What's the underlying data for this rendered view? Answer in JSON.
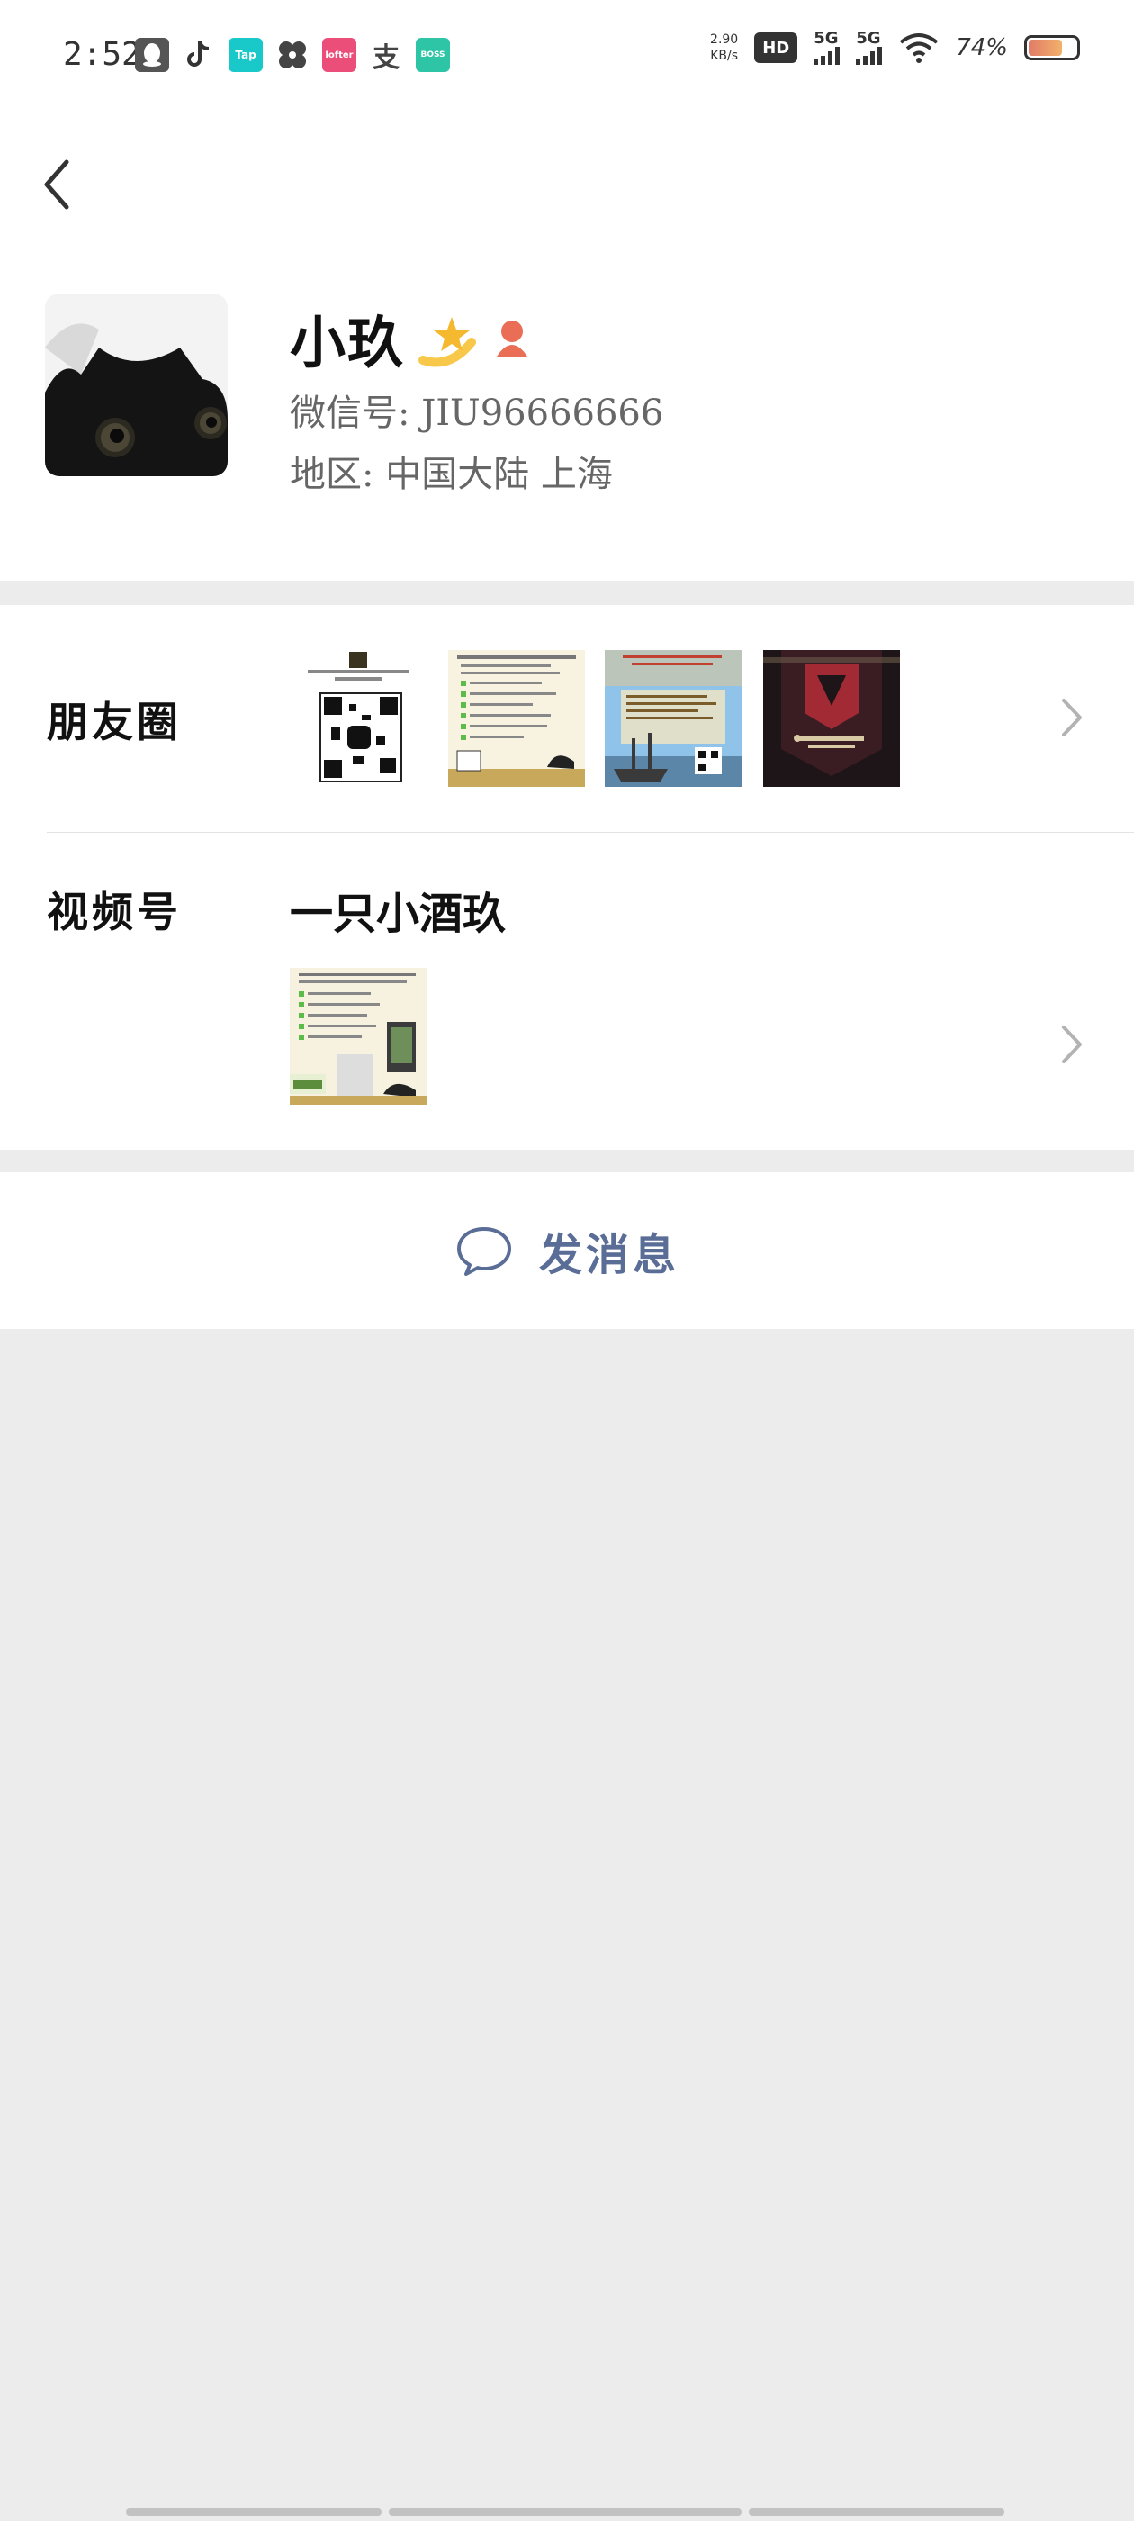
{
  "status_bar": {
    "time": "2:52",
    "net_speed_value": "2.90",
    "net_speed_unit": "KB/s",
    "hd_label": "HD",
    "signal1_label": "5G",
    "signal2_label": "5G",
    "battery_percent": "74%",
    "battery_level": 0.74,
    "app_icons": [
      {
        "name": "qq-icon",
        "color": "#555555",
        "text": ""
      },
      {
        "name": "tiktok-icon",
        "color": "#333333",
        "text": ""
      },
      {
        "name": "taptap-icon",
        "color": "#19c8c8",
        "text": "Tap"
      },
      {
        "name": "pinwheel-icon",
        "color": "#444444",
        "text": ""
      },
      {
        "name": "lofter-icon",
        "color": "#ea4e79",
        "text": "lofter"
      },
      {
        "name": "alipay-icon",
        "color": "#444444",
        "text": "支"
      },
      {
        "name": "boss-zhipin-icon",
        "color": "#2ec4a6",
        "text": "BOSS"
      }
    ]
  },
  "profile": {
    "nickname": "小玖",
    "wechat_id_line": "微信号: JIU96666666",
    "region_line": "地区: 中国大陆 上海"
  },
  "moments": {
    "label": "朋友圈",
    "thumbnails": [
      "qr-poster",
      "text-poster",
      "ship-poster",
      "dark-banner"
    ]
  },
  "channels": {
    "label": "视频号",
    "channel_name": "一只小酒玖"
  },
  "actions": {
    "send_message_label": "发消息"
  },
  "colors": {
    "accent": "#5a6d96",
    "background": "#ececec",
    "card": "#ffffff"
  }
}
